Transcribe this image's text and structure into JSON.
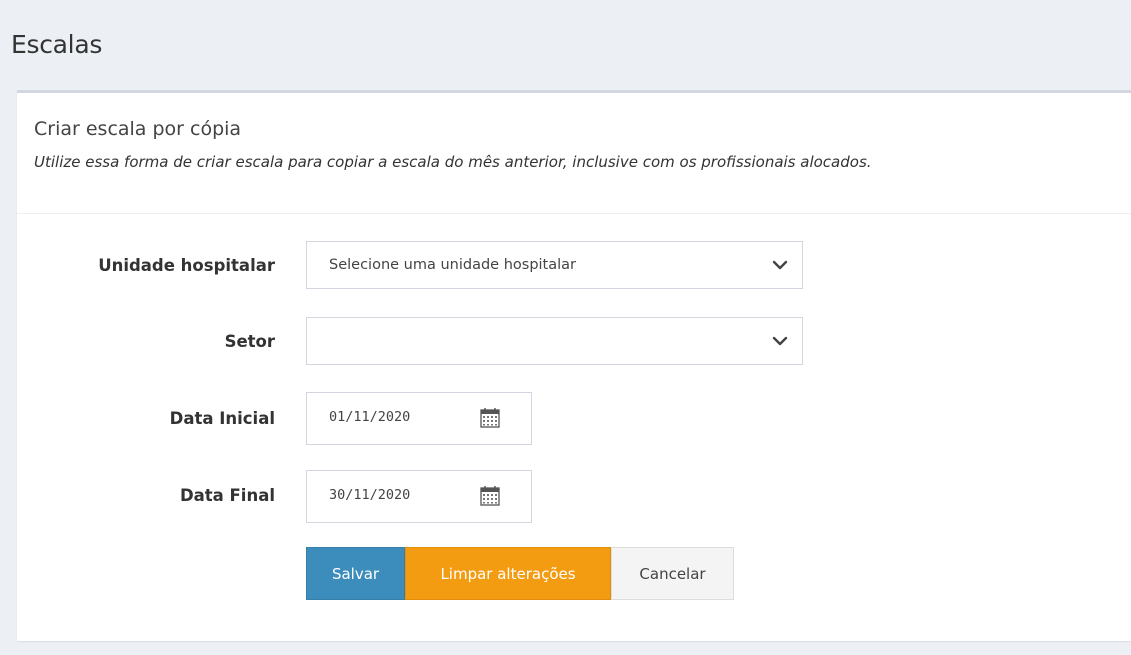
{
  "header": {
    "title": "Escalas"
  },
  "box": {
    "title": "Criar escala por cópia",
    "subtitle": "Utilize essa forma de criar escala para copiar a escala do mês anterior, inclusive com os profissionais alocados."
  },
  "form": {
    "unidade": {
      "label": "Unidade hospitalar",
      "value": "Selecione uma unidade hospitalar",
      "icon": "chevron-down-icon"
    },
    "setor": {
      "label": "Setor",
      "value": "",
      "icon": "chevron-down-icon"
    },
    "data_inicial": {
      "label": "Data Inicial",
      "value": "01/11/2020",
      "icon": "calendar-icon"
    },
    "data_final": {
      "label": "Data Final",
      "value": "30/11/2020",
      "icon": "calendar-icon"
    }
  },
  "buttons": {
    "save_label": "Salvar",
    "clear_label": "Limpar alterações",
    "cancel_label": "Cancelar"
  },
  "colors": {
    "primary": "#3c8dbc",
    "warning": "#f39c12",
    "default": "#f4f4f4",
    "background": "#ecf0f5"
  }
}
